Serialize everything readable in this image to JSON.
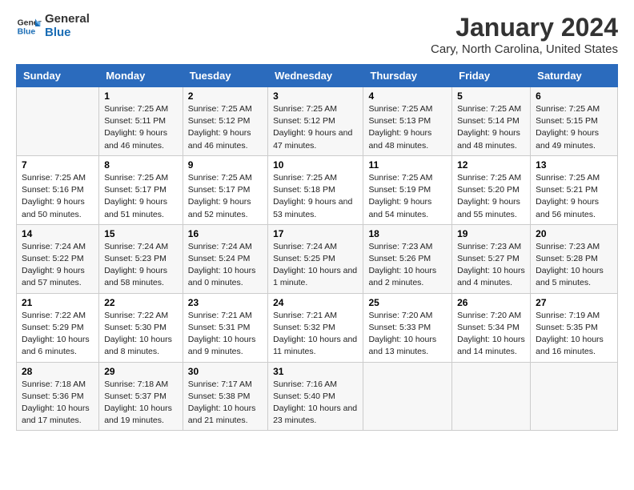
{
  "logo": {
    "line1": "General",
    "line2": "Blue"
  },
  "title": "January 2024",
  "subtitle": "Cary, North Carolina, United States",
  "days": [
    "Sunday",
    "Monday",
    "Tuesday",
    "Wednesday",
    "Thursday",
    "Friday",
    "Saturday"
  ],
  "weeks": [
    [
      {
        "date": "",
        "sunrise": "",
        "sunset": "",
        "daylight": ""
      },
      {
        "date": "1",
        "sunrise": "Sunrise: 7:25 AM",
        "sunset": "Sunset: 5:11 PM",
        "daylight": "Daylight: 9 hours and 46 minutes."
      },
      {
        "date": "2",
        "sunrise": "Sunrise: 7:25 AM",
        "sunset": "Sunset: 5:12 PM",
        "daylight": "Daylight: 9 hours and 46 minutes."
      },
      {
        "date": "3",
        "sunrise": "Sunrise: 7:25 AM",
        "sunset": "Sunset: 5:12 PM",
        "daylight": "Daylight: 9 hours and 47 minutes."
      },
      {
        "date": "4",
        "sunrise": "Sunrise: 7:25 AM",
        "sunset": "Sunset: 5:13 PM",
        "daylight": "Daylight: 9 hours and 48 minutes."
      },
      {
        "date": "5",
        "sunrise": "Sunrise: 7:25 AM",
        "sunset": "Sunset: 5:14 PM",
        "daylight": "Daylight: 9 hours and 48 minutes."
      },
      {
        "date": "6",
        "sunrise": "Sunrise: 7:25 AM",
        "sunset": "Sunset: 5:15 PM",
        "daylight": "Daylight: 9 hours and 49 minutes."
      }
    ],
    [
      {
        "date": "7",
        "sunrise": "Sunrise: 7:25 AM",
        "sunset": "Sunset: 5:16 PM",
        "daylight": "Daylight: 9 hours and 50 minutes."
      },
      {
        "date": "8",
        "sunrise": "Sunrise: 7:25 AM",
        "sunset": "Sunset: 5:17 PM",
        "daylight": "Daylight: 9 hours and 51 minutes."
      },
      {
        "date": "9",
        "sunrise": "Sunrise: 7:25 AM",
        "sunset": "Sunset: 5:17 PM",
        "daylight": "Daylight: 9 hours and 52 minutes."
      },
      {
        "date": "10",
        "sunrise": "Sunrise: 7:25 AM",
        "sunset": "Sunset: 5:18 PM",
        "daylight": "Daylight: 9 hours and 53 minutes."
      },
      {
        "date": "11",
        "sunrise": "Sunrise: 7:25 AM",
        "sunset": "Sunset: 5:19 PM",
        "daylight": "Daylight: 9 hours and 54 minutes."
      },
      {
        "date": "12",
        "sunrise": "Sunrise: 7:25 AM",
        "sunset": "Sunset: 5:20 PM",
        "daylight": "Daylight: 9 hours and 55 minutes."
      },
      {
        "date": "13",
        "sunrise": "Sunrise: 7:25 AM",
        "sunset": "Sunset: 5:21 PM",
        "daylight": "Daylight: 9 hours and 56 minutes."
      }
    ],
    [
      {
        "date": "14",
        "sunrise": "Sunrise: 7:24 AM",
        "sunset": "Sunset: 5:22 PM",
        "daylight": "Daylight: 9 hours and 57 minutes."
      },
      {
        "date": "15",
        "sunrise": "Sunrise: 7:24 AM",
        "sunset": "Sunset: 5:23 PM",
        "daylight": "Daylight: 9 hours and 58 minutes."
      },
      {
        "date": "16",
        "sunrise": "Sunrise: 7:24 AM",
        "sunset": "Sunset: 5:24 PM",
        "daylight": "Daylight: 10 hours and 0 minutes."
      },
      {
        "date": "17",
        "sunrise": "Sunrise: 7:24 AM",
        "sunset": "Sunset: 5:25 PM",
        "daylight": "Daylight: 10 hours and 1 minute."
      },
      {
        "date": "18",
        "sunrise": "Sunrise: 7:23 AM",
        "sunset": "Sunset: 5:26 PM",
        "daylight": "Daylight: 10 hours and 2 minutes."
      },
      {
        "date": "19",
        "sunrise": "Sunrise: 7:23 AM",
        "sunset": "Sunset: 5:27 PM",
        "daylight": "Daylight: 10 hours and 4 minutes."
      },
      {
        "date": "20",
        "sunrise": "Sunrise: 7:23 AM",
        "sunset": "Sunset: 5:28 PM",
        "daylight": "Daylight: 10 hours and 5 minutes."
      }
    ],
    [
      {
        "date": "21",
        "sunrise": "Sunrise: 7:22 AM",
        "sunset": "Sunset: 5:29 PM",
        "daylight": "Daylight: 10 hours and 6 minutes."
      },
      {
        "date": "22",
        "sunrise": "Sunrise: 7:22 AM",
        "sunset": "Sunset: 5:30 PM",
        "daylight": "Daylight: 10 hours and 8 minutes."
      },
      {
        "date": "23",
        "sunrise": "Sunrise: 7:21 AM",
        "sunset": "Sunset: 5:31 PM",
        "daylight": "Daylight: 10 hours and 9 minutes."
      },
      {
        "date": "24",
        "sunrise": "Sunrise: 7:21 AM",
        "sunset": "Sunset: 5:32 PM",
        "daylight": "Daylight: 10 hours and 11 minutes."
      },
      {
        "date": "25",
        "sunrise": "Sunrise: 7:20 AM",
        "sunset": "Sunset: 5:33 PM",
        "daylight": "Daylight: 10 hours and 13 minutes."
      },
      {
        "date": "26",
        "sunrise": "Sunrise: 7:20 AM",
        "sunset": "Sunset: 5:34 PM",
        "daylight": "Daylight: 10 hours and 14 minutes."
      },
      {
        "date": "27",
        "sunrise": "Sunrise: 7:19 AM",
        "sunset": "Sunset: 5:35 PM",
        "daylight": "Daylight: 10 hours and 16 minutes."
      }
    ],
    [
      {
        "date": "28",
        "sunrise": "Sunrise: 7:18 AM",
        "sunset": "Sunset: 5:36 PM",
        "daylight": "Daylight: 10 hours and 17 minutes."
      },
      {
        "date": "29",
        "sunrise": "Sunrise: 7:18 AM",
        "sunset": "Sunset: 5:37 PM",
        "daylight": "Daylight: 10 hours and 19 minutes."
      },
      {
        "date": "30",
        "sunrise": "Sunrise: 7:17 AM",
        "sunset": "Sunset: 5:38 PM",
        "daylight": "Daylight: 10 hours and 21 minutes."
      },
      {
        "date": "31",
        "sunrise": "Sunrise: 7:16 AM",
        "sunset": "Sunset: 5:40 PM",
        "daylight": "Daylight: 10 hours and 23 minutes."
      },
      {
        "date": "",
        "sunrise": "",
        "sunset": "",
        "daylight": ""
      },
      {
        "date": "",
        "sunrise": "",
        "sunset": "",
        "daylight": ""
      },
      {
        "date": "",
        "sunrise": "",
        "sunset": "",
        "daylight": ""
      }
    ]
  ]
}
